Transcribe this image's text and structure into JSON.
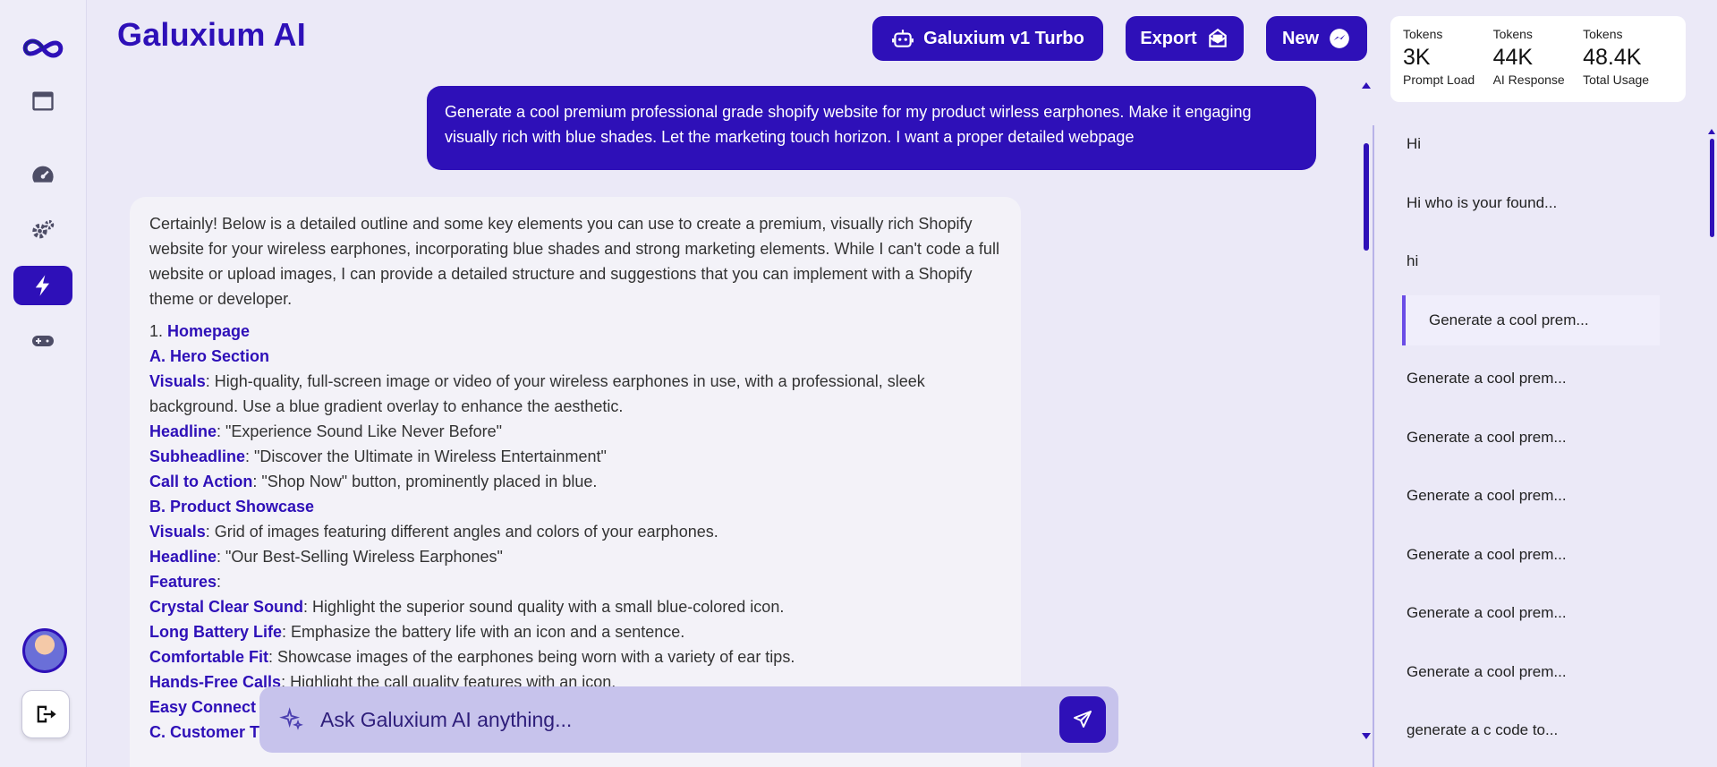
{
  "app": {
    "title": "Galuxium AI"
  },
  "header": {
    "model_label": "Galuxium v1 Turbo",
    "export_label": "Export",
    "new_label": "New"
  },
  "tokens": [
    {
      "heading": "Tokens",
      "value": "3K",
      "caption": "Prompt Load"
    },
    {
      "heading": "Tokens",
      "value": "44K",
      "caption": "AI Response"
    },
    {
      "heading": "Tokens",
      "value": "48.4K",
      "caption": "Total Usage"
    }
  ],
  "sidebar": {
    "items": [
      {
        "icon": "infinity-logo-icon"
      },
      {
        "icon": "window-icon"
      },
      {
        "icon": "dashboard-gauge-icon"
      },
      {
        "icon": "gears-icon"
      },
      {
        "icon": "lightning-icon",
        "active": true
      },
      {
        "icon": "gamepad-icon"
      }
    ],
    "avatar_icon": "user-avatar",
    "logout_icon": "logout-icon"
  },
  "chat": {
    "user_message": "Generate a cool premium professional grade shopify website for my product wirless earphones. Make it engaging visually rich with blue shades. Let the marketing touch horizon. I want a proper detailed webpage",
    "ai_intro": "Certainly! Below is a detailed outline and some key elements you can use to create a premium, visually rich Shopify website for your wireless earphones, incorporating blue shades and strong marketing elements. While I can't code a full website or upload images, I can provide a detailed structure and suggestions that you can implement with a Shopify theme or developer.",
    "ai_lines": [
      {
        "prefix": "1. ",
        "bold": "Homepage",
        "text": ""
      },
      {
        "prefix": "",
        "bold": "A. Hero Section",
        "text": ""
      },
      {
        "prefix": "",
        "bold": "Visuals",
        "text": ": High-quality, full-screen image or video of your wireless earphones in use, with a professional, sleek background. Use a blue gradient overlay to enhance the aesthetic."
      },
      {
        "prefix": "",
        "bold": "Headline",
        "text": ": \"Experience Sound Like Never Before\""
      },
      {
        "prefix": "",
        "bold": "Subheadline",
        "text": ": \"Discover the Ultimate in Wireless Entertainment\""
      },
      {
        "prefix": "",
        "bold": "Call to Action",
        "text": ": \"Shop Now\" button, prominently placed in blue."
      },
      {
        "prefix": "",
        "bold": "B. Product Showcase",
        "text": ""
      },
      {
        "prefix": "",
        "bold": "Visuals",
        "text": ": Grid of images featuring different angles and colors of your earphones."
      },
      {
        "prefix": "",
        "bold": "Headline",
        "text": ": \"Our Best-Selling Wireless Earphones\""
      },
      {
        "prefix": "",
        "bold": "Features",
        "text": ":"
      },
      {
        "prefix": "",
        "bold": "Crystal Clear Sound",
        "text": ": Highlight the superior sound quality with a small blue-colored icon."
      },
      {
        "prefix": "",
        "bold": "Long Battery Life",
        "text": ": Emphasize the battery life with an icon and a sentence."
      },
      {
        "prefix": "",
        "bold": "Comfortable Fit",
        "text": ": Showcase images of the earphones being worn with a variety of ear tips."
      },
      {
        "prefix": "",
        "bold": "Hands-Free Calls",
        "text": ": Highlight the call quality features with an icon."
      },
      {
        "prefix": "",
        "bold": "Easy Connect",
        "text": ""
      },
      {
        "prefix": "",
        "bold": "C. Customer T",
        "text": ""
      }
    ]
  },
  "composer": {
    "placeholder": "Ask Galuxium AI anything..."
  },
  "history": [
    {
      "label": "Hi"
    },
    {
      "label": "Hi who is your found..."
    },
    {
      "label": "hi"
    },
    {
      "label": "Generate a cool prem...",
      "active": true
    },
    {
      "label": "Generate a cool prem..."
    },
    {
      "label": "Generate a cool prem..."
    },
    {
      "label": "Generate a cool prem..."
    },
    {
      "label": "Generate a cool prem..."
    },
    {
      "label": "Generate a cool prem..."
    },
    {
      "label": "Generate a cool prem..."
    },
    {
      "label": "generate a c code to..."
    }
  ],
  "colors": {
    "accent": "#2e10b8",
    "background": "#ebe9f7",
    "composer": "#c7c3ec"
  }
}
